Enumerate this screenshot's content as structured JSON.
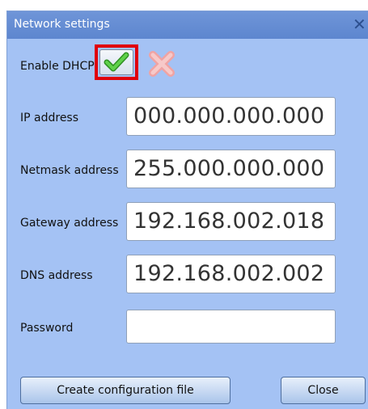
{
  "window": {
    "title": "Network settings",
    "close_glyph": "✕"
  },
  "dhcp": {
    "label": "Enable DHCP",
    "enabled": true,
    "on_icon": "check-icon",
    "off_icon": "cross-icon"
  },
  "fields": {
    "ip": {
      "label": "IP address",
      "value": "000.000.000.000"
    },
    "netmask": {
      "label": "Netmask address",
      "value": "255.000.000.000"
    },
    "gateway": {
      "label": "Gateway address",
      "value": "192.168.002.018"
    },
    "dns": {
      "label": "DNS address",
      "value": "192.168.002.002"
    },
    "password": {
      "label": "Password",
      "value": ""
    }
  },
  "buttons": {
    "create_label": "Create configuration file",
    "close_label": "Close"
  },
  "colors": {
    "window_bg": "#a4c2f4",
    "titlebar": "#5d86cf",
    "highlight": "#e0000a",
    "check_green": "#3bb32d",
    "cross_red": "#e88d8d"
  }
}
